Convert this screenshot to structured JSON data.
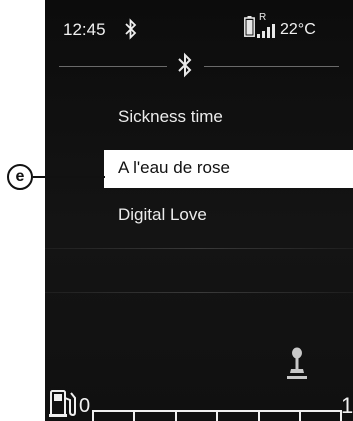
{
  "status": {
    "time": "12:45",
    "signal_label": "R",
    "temperature": "22°C"
  },
  "menu": {
    "items": [
      "Sickness time",
      "A l'eau de rose",
      "Digital Love"
    ],
    "selected_index": 1
  },
  "callout": {
    "label": "e"
  },
  "gauge": {
    "min_label": "0",
    "max_label": "1"
  },
  "colors": {
    "screen_bg": "#101010",
    "highlight": "#ffffff",
    "text": "#ececec"
  }
}
